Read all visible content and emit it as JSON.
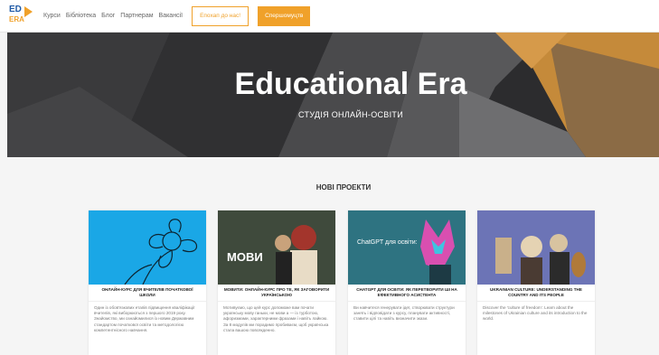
{
  "logo": {
    "line1": "ED",
    "line2": "ERA"
  },
  "nav": {
    "items": [
      "Курси",
      "Бібліотека",
      "Блог",
      "Партнерам",
      "Вакансії"
    ],
    "login_label": "Епохап до нас!",
    "register_label": "Спершомуцтв"
  },
  "hero": {
    "title": "Educational Era",
    "subtitle": "СТУДІЯ ОНЛАЙН-ОСВІТИ"
  },
  "section": {
    "title": "НОВІ ПРОЕКТИ"
  },
  "cards": [
    {
      "title": "ОНЛАЙН-КУРС ДЛЯ ВЧИТЕЛІВ ПОЧАТКОВОЇ ШКОЛИ",
      "desc": "Один із обов'язкових етапів підвищення кваліфікації вчителів, які виборюються з першого 2019 року. Знайомство, ми ознайомилися із новим Державним стандартом початкової освіти та методологією компетентнісного навчання.",
      "thumb_color": "#1aa7e6"
    },
    {
      "title": "МОВИТИ: ОНЛАЙН-КУРС ПРО ТЕ, ЯК ЗАГОВОРИТИ УКРАЇНСЬКОЮ",
      "desc": "Мотивуємо, що цей курс допоможе вам почати українську мову ганьки, не мови а — із турботою, афоризмами, характерними фразами і навіть лайкою. За 8 модулів ми порадимо пробиваєм, щоб українська стала вашою повсякденно.",
      "thumb_color": "#3f4a3c",
      "thumb_text": "МОВИ"
    },
    {
      "title": "CHATGPT ДЛЯ ОСВІТИ: ЯК ПЕРЕТВОРИТИ ШІ НА ЕФЕКТИВНОГО АСИСТЕНТА",
      "desc": "Ви навчитеся генерувати ідеї, створювати структури занять і відповідати з курсу, планувати активності, ставити цілі та навіть визначити зкази.",
      "thumb_color": "#2e7381",
      "thumb_text": "ChatGPT для освіти:"
    },
    {
      "title": "UKRAINIAN CULTURE: UNDERSTANDING THE COUNTRY AND ITS PEOPLE",
      "desc": "Discover the 'culture of freedom'. Learn about the milestones of Ukrainian culture and its introduction to the world.",
      "thumb_color": "#6c74b6"
    }
  ],
  "colors": {
    "accent": "#f0a12a",
    "brand_blue": "#1f5aa6"
  }
}
